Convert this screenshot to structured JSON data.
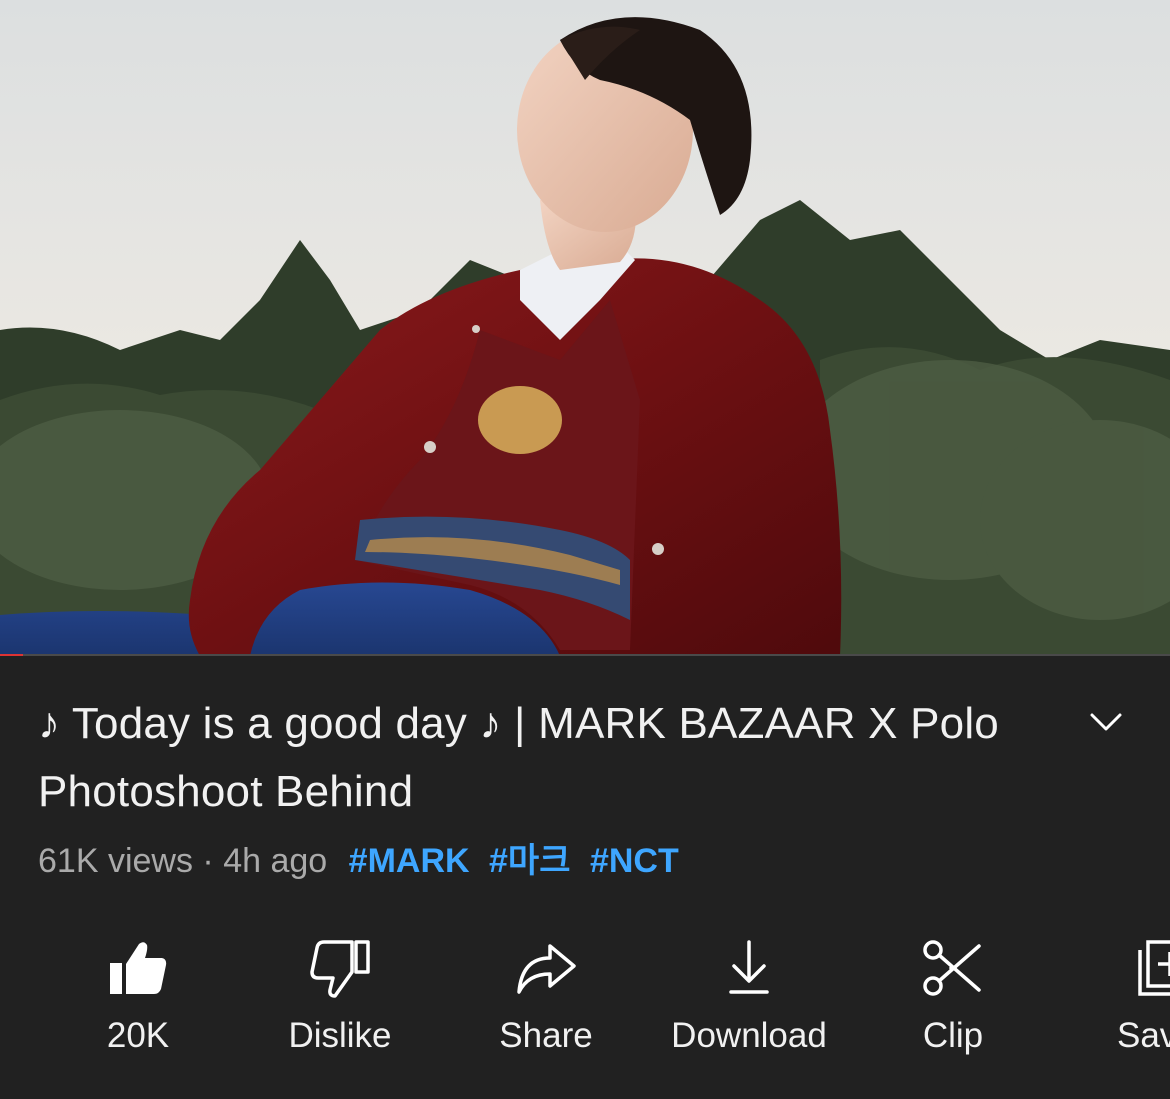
{
  "video": {
    "thumbnail_description": "",
    "progress_fraction": 0.02
  },
  "details": {
    "title": "♪ Today is a good day ♪ | MARK BAZAAR X Polo Photoshoot Behind",
    "views": "61K views",
    "separator": "·",
    "age": "4h ago",
    "hashtags": [
      "#MARK",
      "#마크",
      "#NCT"
    ]
  },
  "actions": {
    "like_count": "20K",
    "dislike_label": "Dislike",
    "share_label": "Share",
    "download_label": "Download",
    "clip_label": "Clip",
    "save_label": "Sav"
  },
  "icons": {
    "expand": "chevron-down-icon",
    "like": "thumbs-up-icon",
    "dislike": "thumbs-down-icon",
    "share": "share-arrow-icon",
    "download": "download-icon",
    "clip": "scissors-icon",
    "save": "add-to-playlist-icon"
  },
  "colors": {
    "background": "#212121",
    "text": "#f1f1f1",
    "muted": "#aaaaaa",
    "hashtag": "#3ea6ff",
    "progress": "#dd3333"
  }
}
